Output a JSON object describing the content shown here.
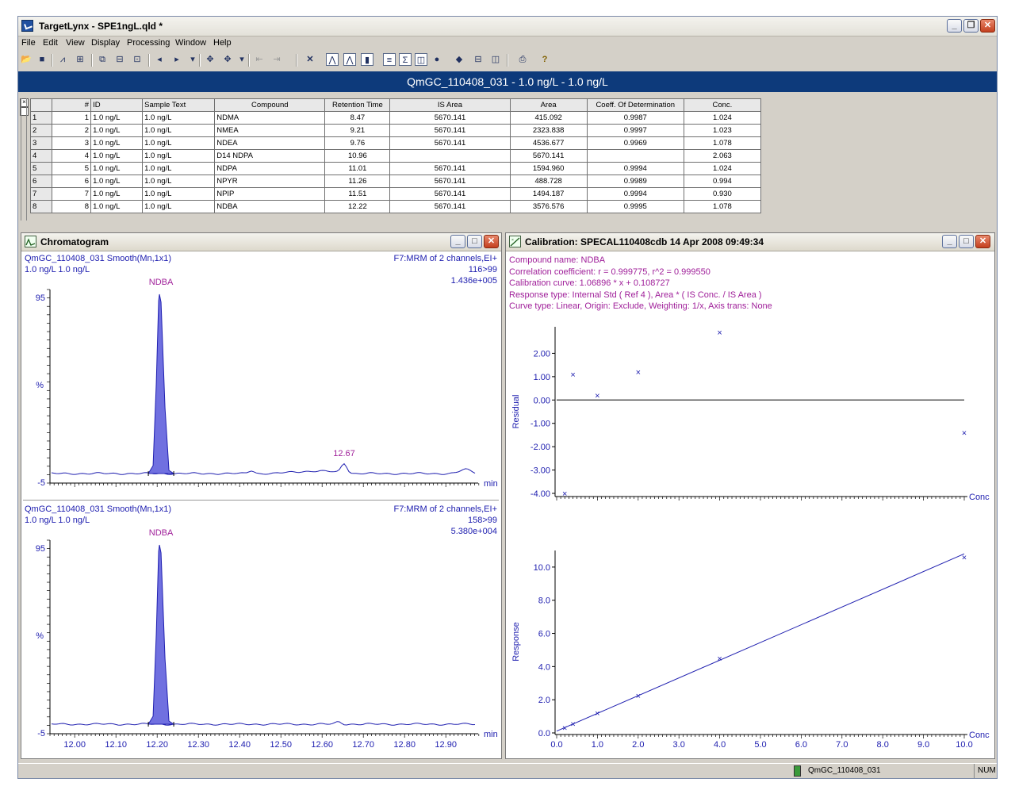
{
  "window": {
    "title": "TargetLynx - SPE1ngL.qld *"
  },
  "menu": [
    "File",
    "Edit",
    "View",
    "Display",
    "Processing",
    "Window",
    "Help"
  ],
  "header_bar": "QmGC_110408_031 - 1.0 ng/L - 1.0 ng/L",
  "table": {
    "columns": [
      "#",
      "ID",
      "Sample Text",
      "Compound",
      "Retention Time",
      "IS Area",
      "Area",
      "Coeff. Of Determination",
      "Conc."
    ],
    "rows": [
      {
        "row": "1",
        "n": "1",
        "id": "1.0 ng/L",
        "text": "1.0 ng/L",
        "compound": "NDMA",
        "rt": "8.47",
        "is_area": "5670.141",
        "area": "415.092",
        "coeff": "0.9987",
        "conc": "1.024"
      },
      {
        "row": "2",
        "n": "2",
        "id": "1.0 ng/L",
        "text": "1.0 ng/L",
        "compound": "NMEA",
        "rt": "9.21",
        "is_area": "5670.141",
        "area": "2323.838",
        "coeff": "0.9997",
        "conc": "1.023"
      },
      {
        "row": "3",
        "n": "3",
        "id": "1.0 ng/L",
        "text": "1.0 ng/L",
        "compound": "NDEA",
        "rt": "9.76",
        "is_area": "5670.141",
        "area": "4536.677",
        "coeff": "0.9969",
        "conc": "1.078"
      },
      {
        "row": "4",
        "n": "4",
        "id": "1.0 ng/L",
        "text": "1.0 ng/L",
        "compound": "D14 NDPA",
        "rt": "10.96",
        "is_area": "",
        "area": "5670.141",
        "coeff": "",
        "conc": "2.063"
      },
      {
        "row": "5",
        "n": "5",
        "id": "1.0 ng/L",
        "text": "1.0 ng/L",
        "compound": "NDPA",
        "rt": "11.01",
        "is_area": "5670.141",
        "area": "1594.960",
        "coeff": "0.9994",
        "conc": "1.024"
      },
      {
        "row": "6",
        "n": "6",
        "id": "1.0 ng/L",
        "text": "1.0 ng/L",
        "compound": "NPYR",
        "rt": "11.26",
        "is_area": "5670.141",
        "area": "488.728",
        "coeff": "0.9989",
        "conc": "0.994"
      },
      {
        "row": "7",
        "n": "7",
        "id": "1.0 ng/L",
        "text": "1.0 ng/L",
        "compound": "NPIP",
        "rt": "11.51",
        "is_area": "5670.141",
        "area": "1494.187",
        "coeff": "0.9994",
        "conc": "0.930"
      },
      {
        "row": "8",
        "n": "8",
        "id": "1.0 ng/L",
        "text": "1.0 ng/L",
        "compound": "NDBA",
        "rt": "12.22",
        "is_area": "5670.141",
        "area": "3576.576",
        "coeff": "0.9995",
        "conc": "1.078"
      }
    ]
  },
  "chromatogram": {
    "title": "Chromatogram",
    "traces": [
      {
        "name": "QmGC_110408_031 Smooth(Mn,1x1)",
        "sub": "1.0 ng/L 1.0 ng/L",
        "func": "F7:MRM of 2 channels,EI+",
        "transition": "116>99",
        "intensity": "1.436e+005",
        "peak_label": "NDBA",
        "minor_peak_label": "12.67",
        "y_top": "95",
        "y_mid": "%",
        "y_bottom": "-5",
        "x_unit": "min"
      },
      {
        "name": "QmGC_110408_031 Smooth(Mn,1x1)",
        "sub": "1.0 ng/L 1.0 ng/L",
        "func": "F7:MRM of 2 channels,EI+",
        "transition": "158>99",
        "intensity": "5.380e+004",
        "peak_label": "NDBA",
        "minor_peak_label": "",
        "y_top": "95",
        "y_mid": "%",
        "y_bottom": "-5",
        "x_unit": "min"
      }
    ],
    "x_ticks": [
      "12.00",
      "12.10",
      "12.20",
      "12.30",
      "12.40",
      "12.50",
      "12.60",
      "12.70",
      "12.80",
      "12.90"
    ]
  },
  "calibration": {
    "title": "Calibration: SPECAL110408cdb 14 Apr 2008 09:49:34",
    "info": [
      "Compound name: NDBA",
      "Correlation coefficient: r = 0.999775, r^2 = 0.999550",
      "Calibration curve: 1.06896 * x + 0.108727",
      "Response type: Internal Std ( Ref 4 ), Area * ( IS Conc. / IS Area )",
      "Curve type: Linear, Origin: Exclude, Weighting: 1/x, Axis trans: None"
    ],
    "residual_ylabel": "Residual",
    "response_ylabel": "Response",
    "x_unit": "Conc"
  },
  "chart_data": [
    {
      "type": "scatter",
      "title": "",
      "xlabel": "Conc",
      "ylabel": "Residual",
      "xlim": [
        0,
        10.0
      ],
      "ylim": [
        -4.0,
        3.0
      ],
      "y_ticks": [
        "2.00",
        "1.00",
        "0.00",
        "-1.00",
        "-2.00",
        "-3.00",
        "-4.00"
      ],
      "points": [
        [
          0.2,
          -4.0
        ],
        [
          0.4,
          1.1
        ],
        [
          1.0,
          0.2
        ],
        [
          2.0,
          1.2
        ],
        [
          4.0,
          2.9
        ],
        [
          10.0,
          -1.4
        ]
      ]
    },
    {
      "type": "scatter",
      "title": "",
      "xlabel": "Conc",
      "ylabel": "Response",
      "xlim": [
        0,
        10.0
      ],
      "ylim": [
        0,
        11.0
      ],
      "x_ticks": [
        "0.0",
        "1.0",
        "2.0",
        "3.0",
        "4.0",
        "5.0",
        "6.0",
        "7.0",
        "8.0",
        "9.0",
        "10.0"
      ],
      "y_ticks": [
        "10.0",
        "8.0",
        "6.0",
        "4.0",
        "2.0",
        "0.0"
      ],
      "points": [
        [
          0.2,
          0.3
        ],
        [
          0.4,
          0.55
        ],
        [
          1.0,
          1.2
        ],
        [
          2.0,
          2.25
        ],
        [
          4.0,
          4.5
        ],
        [
          10.0,
          10.6
        ]
      ],
      "fit": {
        "slope": 1.06896,
        "intercept": 0.108727
      }
    }
  ],
  "status": {
    "file": "QmGC_110408_031",
    "mode": "NUM"
  }
}
